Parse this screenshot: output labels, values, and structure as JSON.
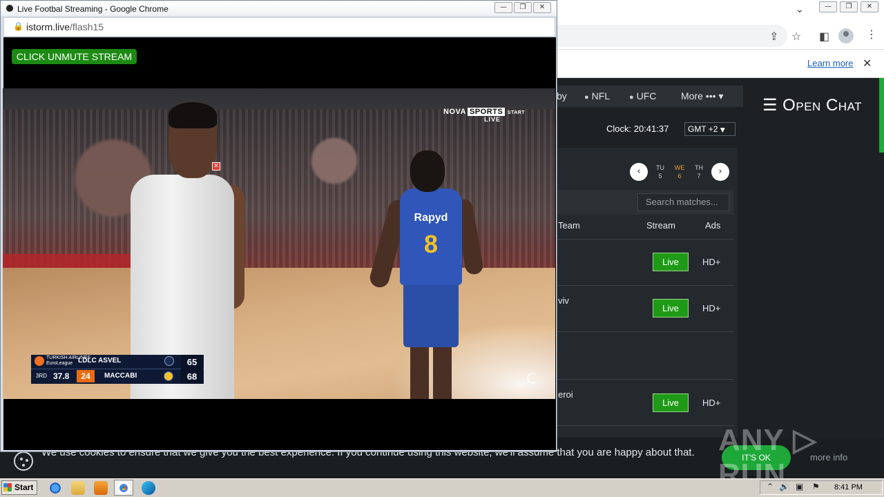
{
  "popup": {
    "title": "Live Footbal Streaming - Google Chrome",
    "url_host": "istorm.live",
    "url_path": "/flash15",
    "unmute_label": "CLICK UNMUTE STREAM",
    "window_buttons": [
      "minimize",
      "restore",
      "close"
    ]
  },
  "video": {
    "broadcaster": "NOVA",
    "broadcaster_sports": "SPORTS",
    "broadcaster_start": "START",
    "live_label": "LIVE",
    "jersey_brand": "Rapyd",
    "jersey_number": "8",
    "scorebug": {
      "league_line1": "TURKISH AIRLINES",
      "league_line2": "EuroLeague",
      "team1": "LDLC ASVEL",
      "score1": "65",
      "team2": "MACCABI",
      "score2": "68",
      "quarter": "3RD",
      "game_clock": "37.8",
      "shot_clock": "24"
    }
  },
  "background_page": {
    "learn_more": "Learn more",
    "nav": [
      {
        "label": "by"
      },
      {
        "label": "NFL",
        "icon": "football-icon"
      },
      {
        "label": "UFC",
        "icon": "glove-icon"
      },
      {
        "label": "More ••• ▾"
      }
    ],
    "open_chat": "☰ Open Chat",
    "clock_label": "Clock: 20:41:37",
    "timezone": "GMT +2",
    "days": [
      {
        "abbr": "TU",
        "num": "5"
      },
      {
        "abbr": "WE",
        "num": "6",
        "active": true
      },
      {
        "abbr": "TH",
        "num": "7"
      }
    ],
    "search_placeholder": "Search matches...",
    "columns": [
      "Team",
      "Stream",
      "Ads"
    ],
    "rows": [
      {
        "team": "",
        "stream": "Live",
        "ads": "HD+"
      },
      {
        "team": "viv",
        "stream": "Live",
        "ads": "HD+"
      },
      {
        "team": "",
        "stream": "",
        "ads": ""
      },
      {
        "team": "eroi",
        "stream": "Live",
        "ads": "HD+"
      }
    ],
    "cookie_text": "We use cookies to ensure that we give you the best experience. If you continue using this website, we'll assume that you are happy about that.",
    "cookie_ok": "IT'S OK",
    "cookie_more": "more info"
  },
  "watermark": "ANY ▷ RUN",
  "taskbar": {
    "start_label": "Start",
    "time": "8:41 PM"
  }
}
